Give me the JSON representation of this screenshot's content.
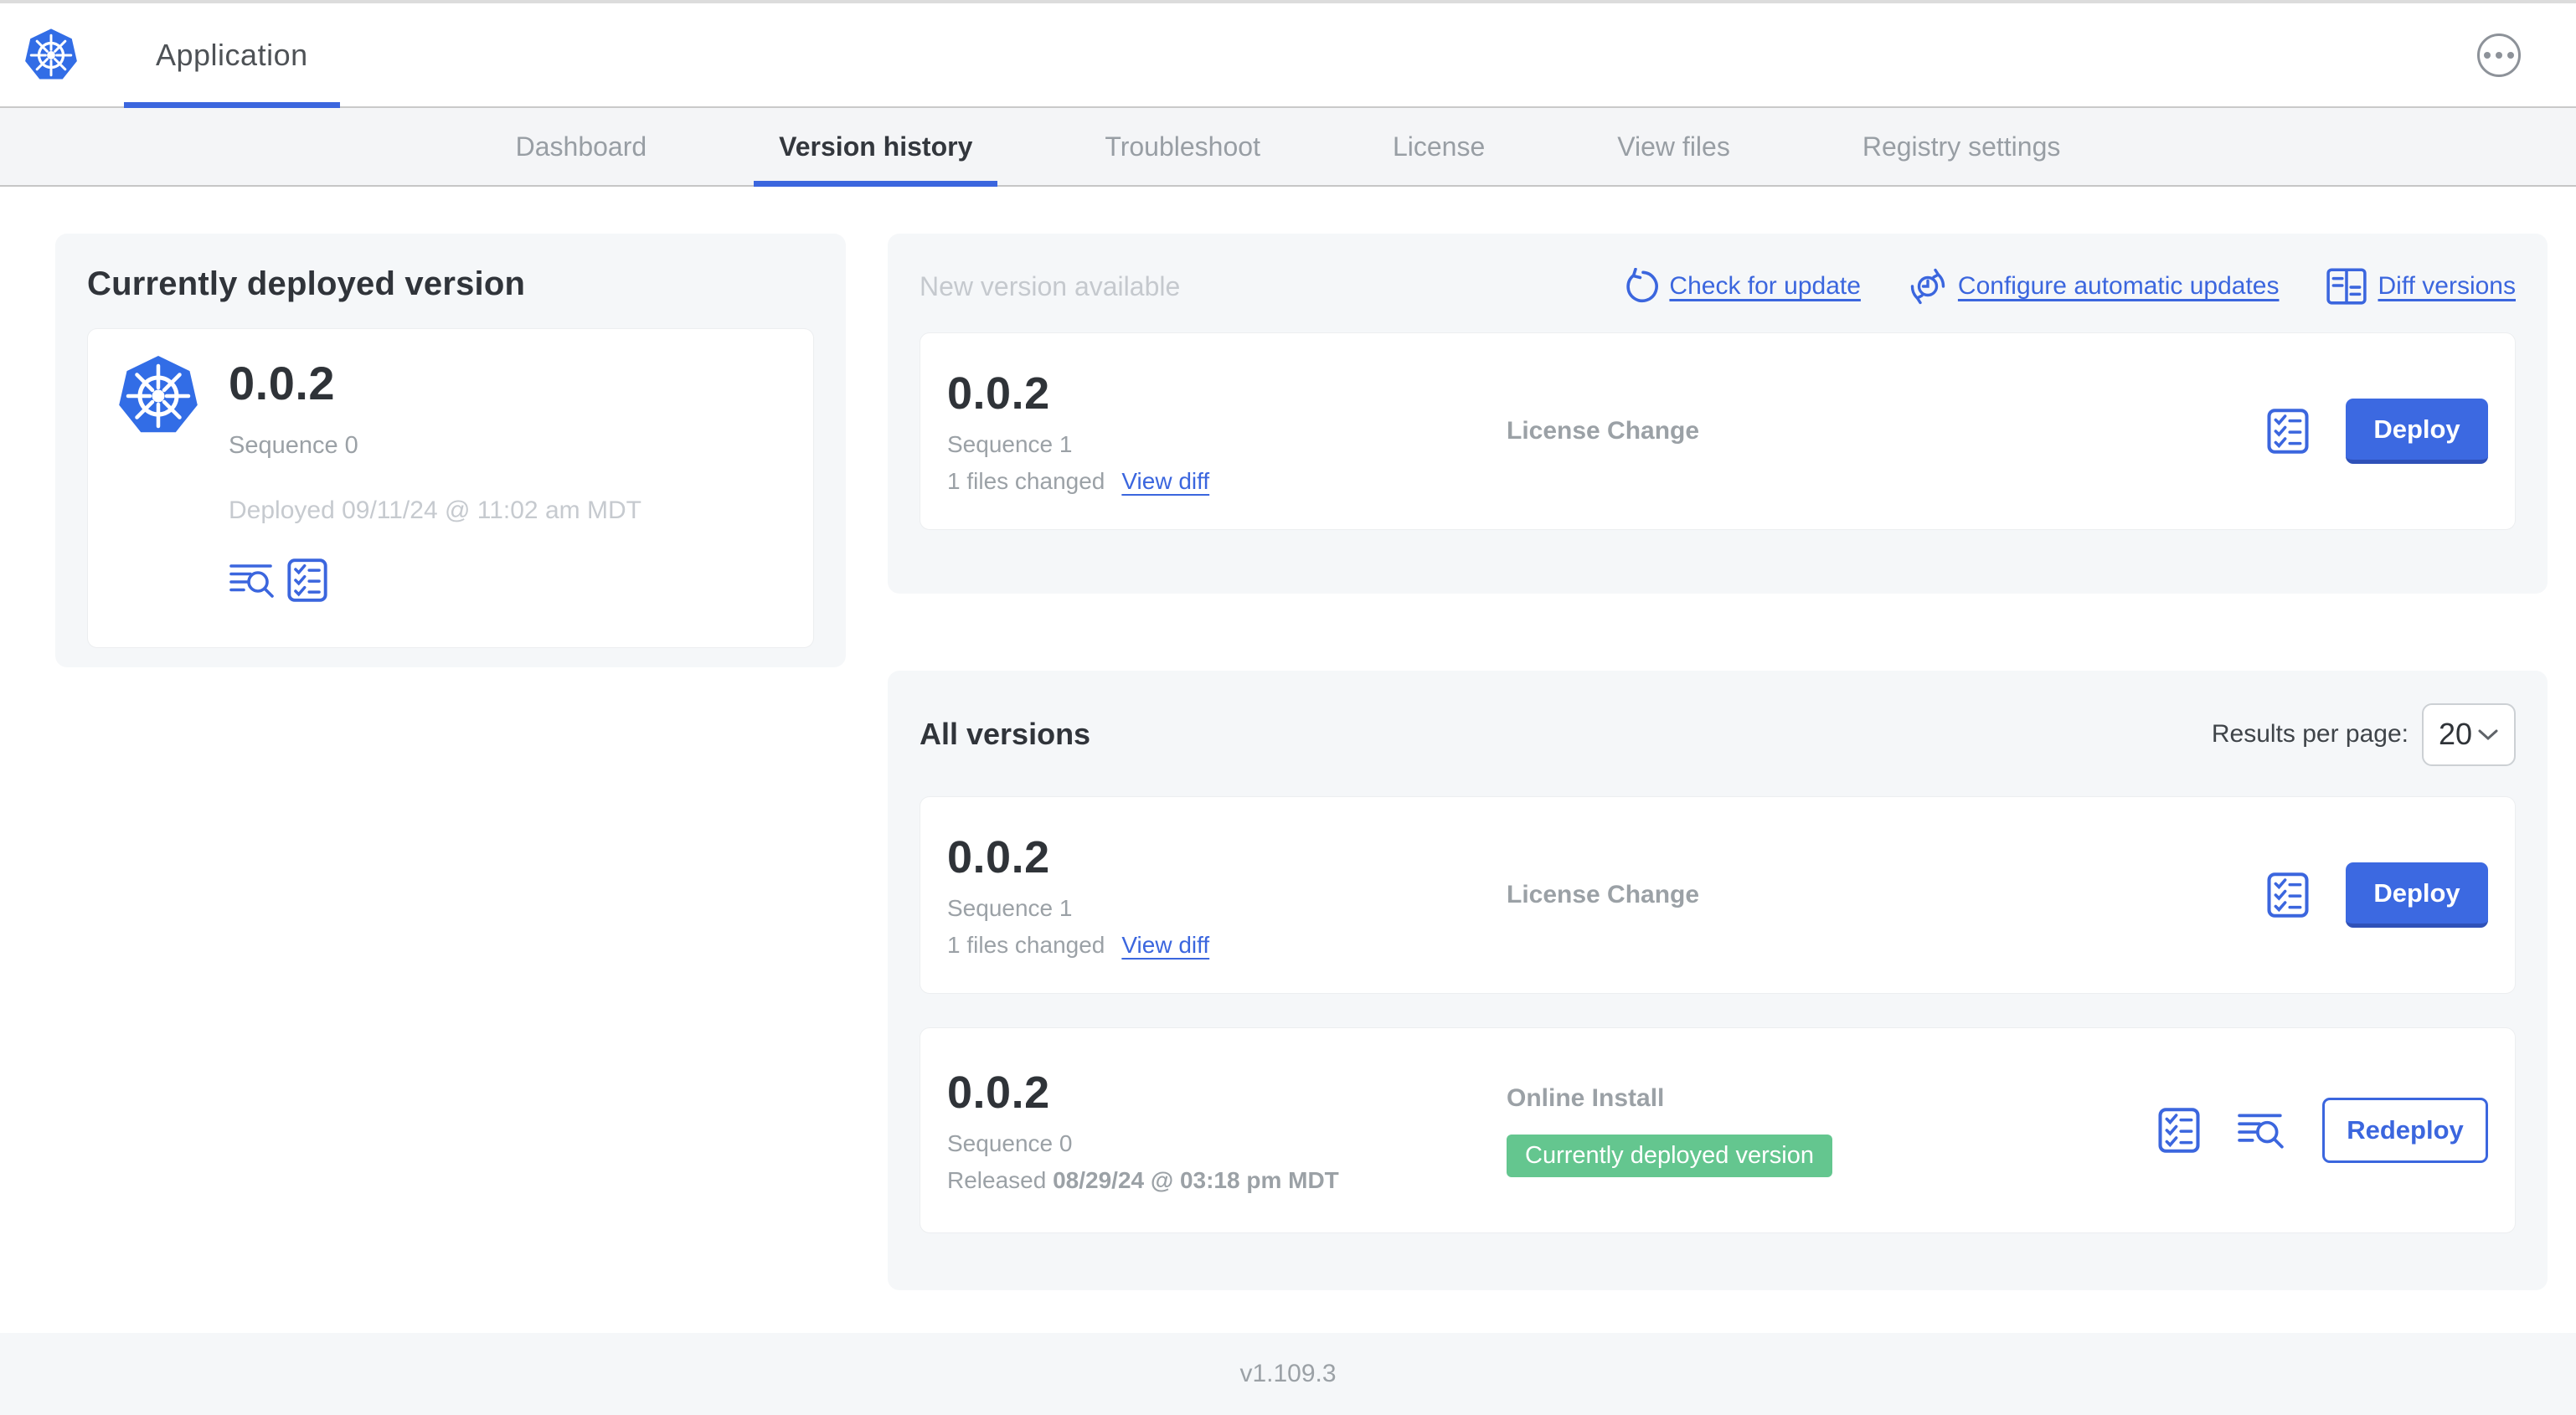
{
  "header": {
    "title": "Application"
  },
  "nav": {
    "tabs": [
      "Dashboard",
      "Version history",
      "Troubleshoot",
      "License",
      "View files",
      "Registry settings"
    ],
    "active_tab": "Version history"
  },
  "currently_deployed": {
    "heading": "Currently deployed version",
    "version": "0.0.2",
    "sequence": "Sequence 0",
    "deployed_at": "Deployed 09/11/24 @ 11:02 am MDT"
  },
  "new_version": {
    "heading": "New version available",
    "links": {
      "check": "Check for update",
      "configure": "Configure automatic updates",
      "diff": "Diff versions"
    },
    "card": {
      "version": "0.0.2",
      "sequence": "Sequence 1",
      "files_changed": "1 files changed",
      "view_diff": "View diff",
      "source": "License Change",
      "action": "Deploy"
    }
  },
  "all_versions": {
    "heading": "All versions",
    "results_label": "Results per page:",
    "results_value": "20",
    "rows": [
      {
        "version": "0.0.2",
        "sequence": "Sequence 1",
        "files_changed": "1 files changed",
        "view_diff": "View diff",
        "source": "License Change",
        "action": "Deploy"
      },
      {
        "version": "0.0.2",
        "sequence": "Sequence 0",
        "released_label": "Released",
        "released_date": "08/29/24 @ 03:18 pm MDT",
        "source": "Online Install",
        "badge": "Currently deployed version",
        "action": "Redeploy"
      }
    ]
  },
  "footer": {
    "app_version": "v1.109.3"
  },
  "icons": [
    "kubernetes-logo",
    "ellipsis-icon",
    "refresh-icon",
    "auto-update-clock-icon",
    "diff-icon",
    "preflight-checklist-icon",
    "logs-icon",
    "chevron-down-icon"
  ],
  "colors": {
    "accent": "#3b66de",
    "kubernetes_blue": "#326de6",
    "success_green": "#64c68f",
    "panel_gray": "#f5f7f9"
  }
}
